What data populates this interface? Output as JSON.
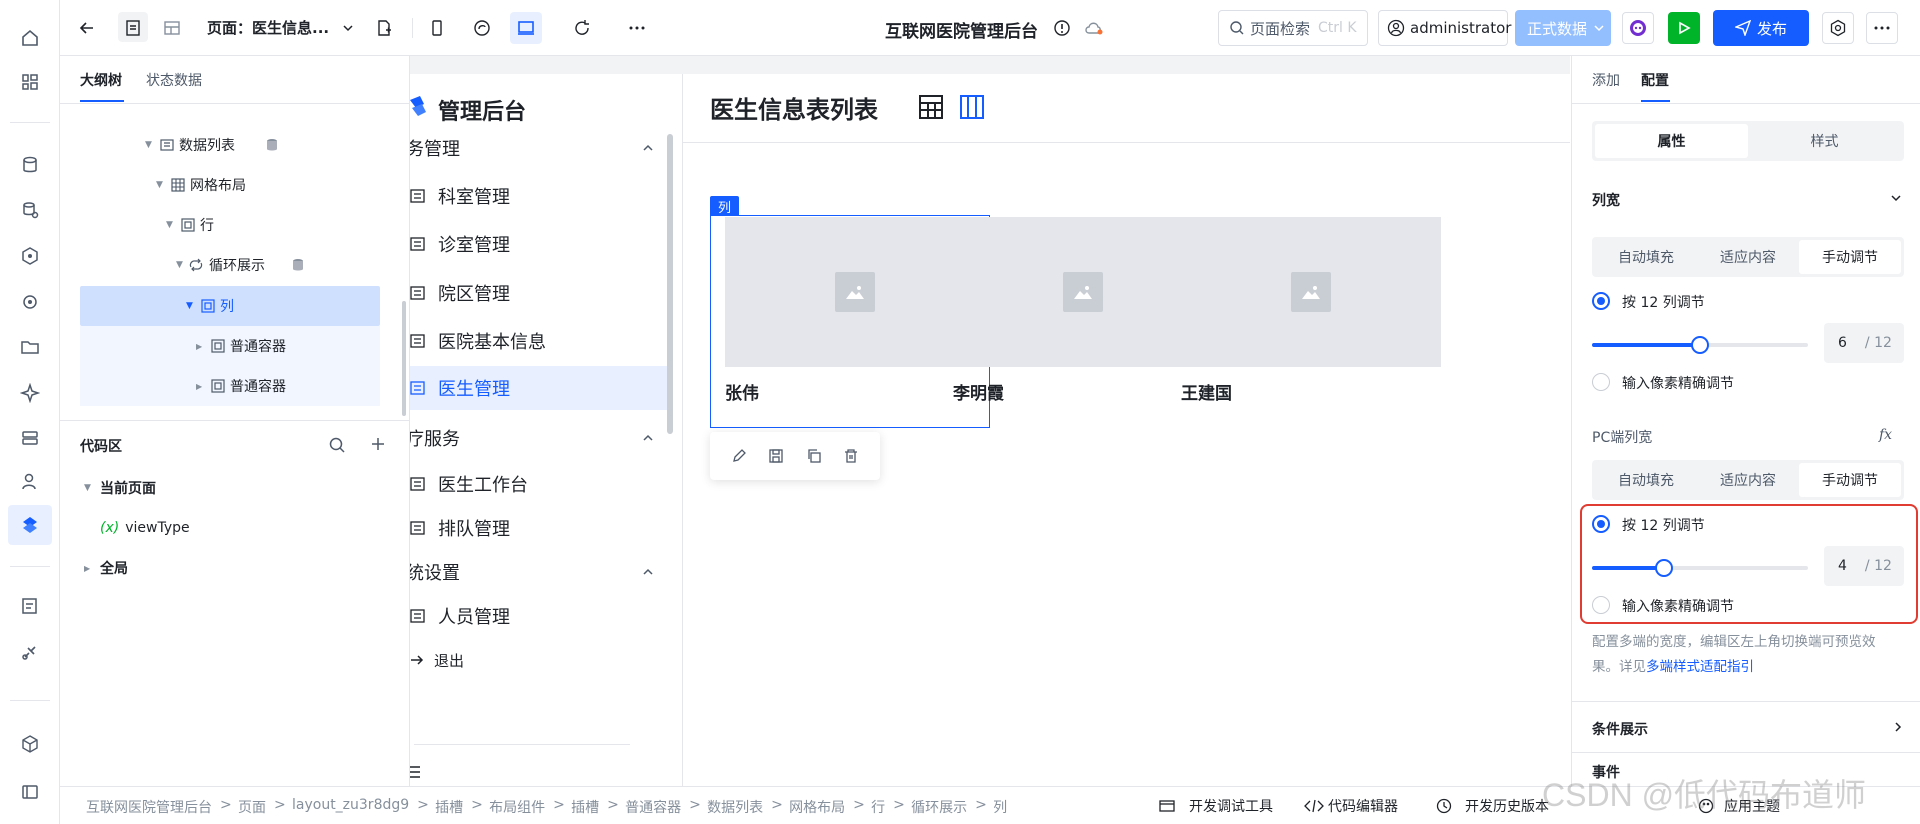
{
  "topbar": {
    "page_label": "页面：医生信息...",
    "app_title": "互联网医院管理后台",
    "search_placeholder": "页面检索",
    "search_shortcut": "Ctrl K",
    "user": "administrator",
    "env": "正式数据",
    "publish": "发布"
  },
  "left": {
    "tabs": [
      "大纲树",
      "状态数据"
    ],
    "tree": [
      {
        "label": "数据列表",
        "expanded": true,
        "icon": "list-icon",
        "db": true
      },
      {
        "label": "网格布局",
        "expanded": true,
        "icon": "grid-icon"
      },
      {
        "label": "行",
        "expanded": true,
        "icon": "box-icon"
      },
      {
        "label": "循环展示",
        "expanded": true,
        "icon": "loop-icon",
        "db": true
      },
      {
        "label": "列",
        "expanded": true,
        "icon": "box-icon",
        "selected": true
      },
      {
        "label": "普通容器",
        "expanded": false,
        "icon": "box-icon"
      },
      {
        "label": "普通容器",
        "expanded": false,
        "icon": "box-icon"
      }
    ],
    "code_title": "代码区",
    "code_tree": {
      "current_page": "当前页面",
      "var_prefix": "(x)",
      "var_name": "viewType",
      "global": "全局"
    }
  },
  "canvas": {
    "brand": "管理后台",
    "menu": [
      {
        "type": "group",
        "label": "务管理"
      },
      {
        "type": "item",
        "label": "科室管理"
      },
      {
        "type": "item",
        "label": "诊室管理"
      },
      {
        "type": "item",
        "label": "院区管理"
      },
      {
        "type": "item",
        "label": "医院基本信息"
      },
      {
        "type": "item",
        "label": "医生管理",
        "active": true
      },
      {
        "type": "group",
        "label": "疗服务"
      },
      {
        "type": "item",
        "label": "医生工作台"
      },
      {
        "type": "item",
        "label": "排队管理"
      },
      {
        "type": "group",
        "label": "统设置"
      },
      {
        "type": "item",
        "label": "人员管理"
      },
      {
        "type": "logout",
        "label": "退出"
      }
    ],
    "page_title": "医生信息表列表",
    "col_tag": "列",
    "cards": [
      "张伟",
      "李明霞",
      "王建国"
    ]
  },
  "right": {
    "tabs": [
      "添加",
      "配置"
    ],
    "seg": [
      "属性",
      "样式"
    ],
    "col_width": {
      "title": "列宽",
      "modes": [
        "自动填充",
        "适应内容",
        "手动调节"
      ],
      "radio_12": "按 12 列调节",
      "value": "6",
      "total": "/ 12",
      "radio_px": "输入像素精确调节"
    },
    "pc_width": {
      "title": "PC端列宽",
      "modes": [
        "自动填充",
        "适应内容",
        "手动调节"
      ],
      "radio_12": "按 12 列调节",
      "value": "4",
      "total": "/ 12",
      "radio_px": "输入像素精确调节"
    },
    "hint": "配置多端的宽度，编辑区左上角切换端可预览效果。详见",
    "hint_link": "多端样式适配指引",
    "cond": "条件展示",
    "events": "事件"
  },
  "bottom": {
    "crumbs": [
      "互联网医院管理后台",
      "页面",
      "layout_zu3r8dg9",
      "插槽",
      "布局组件",
      "插槽",
      "普通容器",
      "数据列表",
      "网格布局",
      "行",
      "循环展示",
      "列"
    ],
    "tools": [
      "开发调试工具",
      "代码编辑器",
      "开发历史版本",
      "应用主题"
    ]
  },
  "watermark": "CSDN @低代码布道师",
  "colors": {
    "accent": "#165dff",
    "highlight": "#f53f3f",
    "selected_bg": "#cfe0ff"
  }
}
